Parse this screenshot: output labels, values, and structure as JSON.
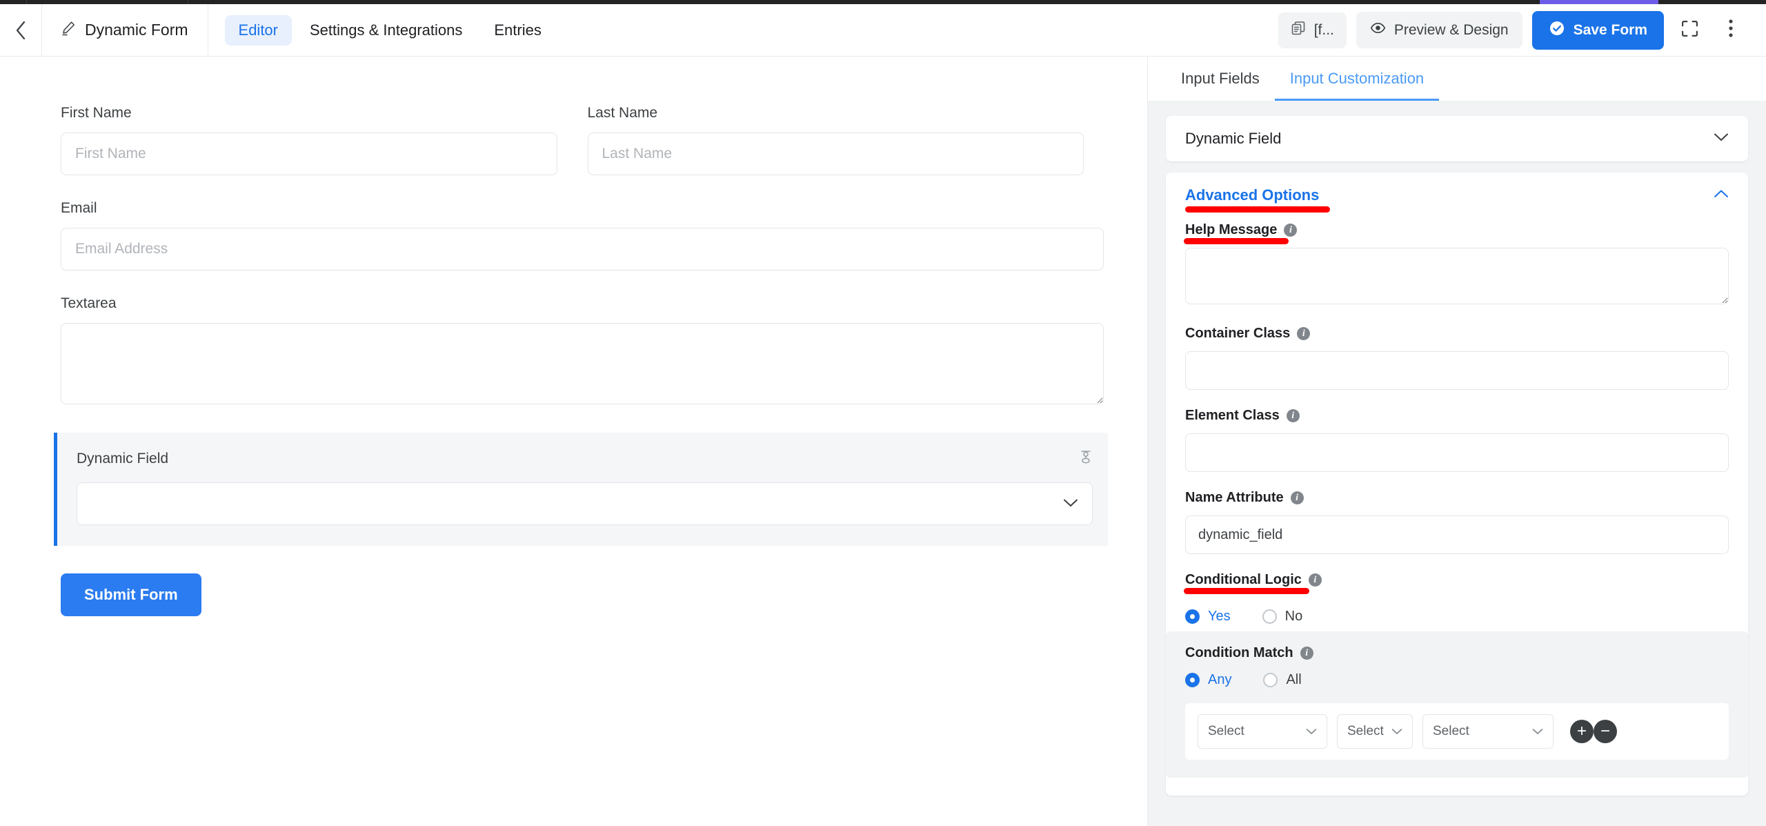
{
  "header": {
    "back_icon": "chevron-left-icon",
    "pencil_icon": "pencil-icon",
    "form_title": "Dynamic Form",
    "tabs": [
      {
        "label": "Editor",
        "active": true
      },
      {
        "label": "Settings & Integrations",
        "active": false
      },
      {
        "label": "Entries",
        "active": false
      }
    ],
    "shortcode_button": "[f...",
    "shortcode_icon": "copy-icon",
    "preview_button": "Preview & Design",
    "preview_icon": "eye-icon",
    "save_button": "Save Form",
    "save_icon": "check-circle-icon",
    "fullscreen_icon": "fullscreen-icon",
    "more_icon": "more-vertical-icon"
  },
  "canvas": {
    "fields": [
      {
        "label": "First Name",
        "placeholder": "First Name",
        "value": ""
      },
      {
        "label": "Last Name",
        "placeholder": "Last Name",
        "value": ""
      },
      {
        "label": "Email",
        "placeholder": "Email Address",
        "value": ""
      },
      {
        "label": "Textarea",
        "placeholder": "",
        "value": ""
      }
    ],
    "selected_field": {
      "label": "Dynamic Field",
      "value": "",
      "caret_icon": "chevron-down-icon",
      "tool_icon": "settings-handle-icon"
    },
    "submit_label": "Submit Form"
  },
  "panel": {
    "tabs": [
      {
        "label": "Input Fields",
        "active": false
      },
      {
        "label": "Input Customization",
        "active": true
      }
    ],
    "field_card": {
      "title": "Dynamic Field",
      "chevron": "chevron-down-icon"
    },
    "advanced": {
      "title": "Advanced Options",
      "chevron": "chevron-up-icon",
      "help_message": {
        "label": "Help Message",
        "info_icon": "info-icon",
        "value": "",
        "placeholder": ""
      },
      "container_class": {
        "label": "Container Class",
        "info_icon": "info-icon",
        "value": "",
        "placeholder": ""
      },
      "element_class": {
        "label": "Element Class",
        "info_icon": "info-icon",
        "value": "",
        "placeholder": ""
      },
      "name_attribute": {
        "label": "Name Attribute",
        "info_icon": "info-icon",
        "value": "dynamic_field",
        "placeholder": ""
      },
      "conditional_logic": {
        "label": "Conditional Logic",
        "info_icon": "info-icon",
        "options": [
          {
            "label": "Yes",
            "selected": true
          },
          {
            "label": "No",
            "selected": false
          }
        ]
      },
      "condition_match": {
        "label": "Condition Match",
        "info_icon": "info-icon",
        "options": [
          {
            "label": "Any",
            "selected": true
          },
          {
            "label": "All",
            "selected": false
          }
        ]
      },
      "rule_row": {
        "field_select": "Select",
        "operator_select": "Select",
        "value_select": "Select",
        "caret_icon": "chevron-down-icon",
        "add_label": "+",
        "remove_label": "−"
      }
    }
  },
  "colors": {
    "accent_blue": "#1a73e8",
    "tab_blue": "#4a9af5",
    "annotation_red": "#ff0000",
    "panel_bg": "#f1f3f4",
    "dark_btn": "#3c4043"
  }
}
